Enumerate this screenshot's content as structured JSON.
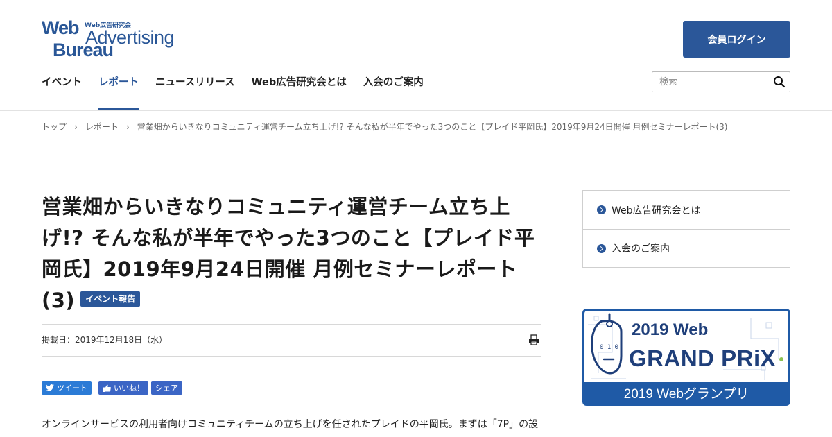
{
  "logo": {
    "top_small": "Web広告研究会",
    "line1": "Web",
    "line2": "Advertising",
    "line3": "Bureau"
  },
  "header": {
    "login_label": "会員ログイン",
    "search_placeholder": "検索"
  },
  "nav": {
    "items": [
      {
        "label": "イベント",
        "active": false
      },
      {
        "label": "レポート",
        "active": true
      },
      {
        "label": "ニュースリリース",
        "active": false
      },
      {
        "label": "Web広告研究会とは",
        "active": false
      },
      {
        "label": "入会のご案内",
        "active": false
      }
    ]
  },
  "breadcrumb": [
    "トップ",
    "レポート",
    "営業畑からいきなりコミュニティ運営チーム立ち上げ!? そんな私が半年でやった3つのこと【プレイド平岡氏】2019年9月24日開催 月例セミナーレポート(3)"
  ],
  "article": {
    "title": "営業畑からいきなりコミュニティ運営チーム立ち上げ!? そんな私が半年でやった3つのこと【プレイド平岡氏】2019年9月24日開催 月例セミナーレポート(3)",
    "tag": "イベント報告",
    "date": "掲載日：2019年12月18日（水）",
    "social": {
      "tweet": "ツイート",
      "like": "いいね！",
      "share": "シェア"
    },
    "lead": "オンラインサービスの利用者向けコミュニティチームの立ち上げを任されたプレイドの平岡氏。まずは「7P」の設"
  },
  "sidebar": {
    "items": [
      "Web広告研究会とは",
      "入会のご案内"
    ]
  },
  "banner": {
    "line1": "2019 Web",
    "line2": "GRAND PRiX",
    "caption": "2019 Webグランプリ"
  },
  "colors": {
    "brand": "#2b5799",
    "banner": "#1f5aa6",
    "twitter": "#2b7bd6",
    "facebook": "#3b65c5"
  }
}
